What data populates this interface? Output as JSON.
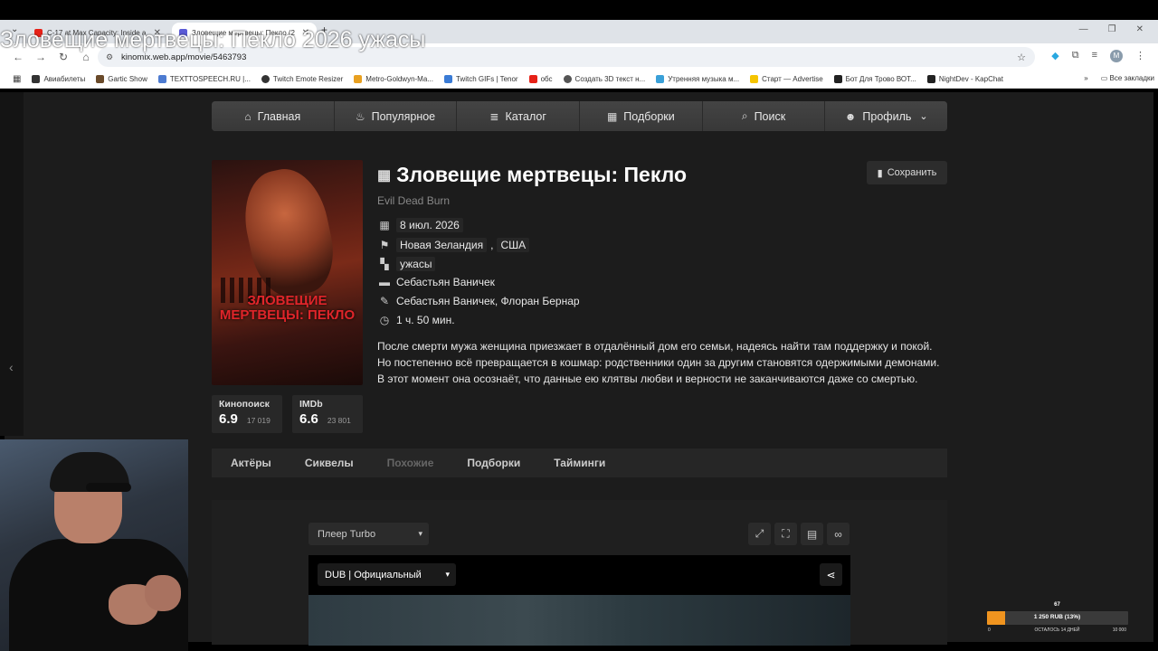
{
  "browser": {
    "tabs": [
      {
        "title": "C-17 at Max Capacity: Inside a",
        "favicon_color": "#e62117"
      },
      {
        "title": "Зловещие мертвецы: Пекло (2",
        "favicon_color": "#5b5bd6"
      }
    ],
    "new_tab_symbol": "+",
    "url": "kinomix.web.app/movie/5463793",
    "profile_initial": "M",
    "bookmarks": [
      {
        "label": "Авиабилеты",
        "icon_color": "#333"
      },
      {
        "label": "Gartic Show",
        "icon_color": "#6a4a2a"
      },
      {
        "label": "TEXTTOSPEECH.RU |...",
        "icon_color": "#4d7bd1"
      },
      {
        "label": "Twitch Emote Resizer",
        "icon_color": "#333"
      },
      {
        "label": "Metro-Goldwyn-Ma...",
        "icon_color": "#e8a020"
      },
      {
        "label": "Twitch GIFs | Tenor",
        "icon_color": "#3a7bd5"
      },
      {
        "label": "обс",
        "icon_color": "#e62117"
      },
      {
        "label": "Создать 3D текст н...",
        "icon_color": "#555"
      },
      {
        "label": "Утренняя музыка м...",
        "icon_color": "#3aa0d8"
      },
      {
        "label": "Старт — Advertise",
        "icon_color": "#f5c400"
      },
      {
        "label": "Бот Для Трово ВОТ...",
        "icon_color": "#222"
      },
      {
        "label": "NightDev - KapChat",
        "icon_color": "#222"
      }
    ],
    "all_bookmarks": "Все закладки"
  },
  "overlay_title": "Зловещие мертвецы: Пекло 2026 ужасы",
  "site_nav": [
    {
      "label": "Главная",
      "icon": "home-icon",
      "glyph": "⌂"
    },
    {
      "label": "Популярное",
      "icon": "fire-icon",
      "glyph": "♨"
    },
    {
      "label": "Каталог",
      "icon": "layers-icon",
      "glyph": "≣"
    },
    {
      "label": "Подборки",
      "icon": "collections-icon",
      "glyph": "▦"
    },
    {
      "label": "Поиск",
      "icon": "search-icon",
      "glyph": "⌕"
    },
    {
      "label": "Профиль",
      "icon": "user-icon",
      "glyph": "☻",
      "dropdown": "⌄"
    }
  ],
  "movie": {
    "title": "Зловещие мертвецы: Пекло",
    "original_title": "Evil Dead Burn",
    "poster_text": "ЗЛОВЕЩИЕ МЕРТВЕЦЫ: ПЕКЛО",
    "date": "8 июл. 2026",
    "countries": [
      "Новая Зеландия",
      "США"
    ],
    "country_sep": ",",
    "genre": "ужасы",
    "director": "Себастьян Ваничек",
    "writers": "Себастьян Ваничек, Флоран Бернар",
    "duration": "1 ч. 50 мин.",
    "description": "После смерти мужа женщина приезжает в отдалённый дом его семьи, надеясь найти там поддержку и покой. Но постепенно всё превращается в кошмар: родственники один за другим становятся одержимыми демонами. В этот момент она осознаёт, что данные ею клятвы любви и верности не заканчиваются даже со смертью.",
    "save_label": "Сохранить"
  },
  "ratings": [
    {
      "source": "Кинопоиск",
      "value": "6.9",
      "votes": "17 019"
    },
    {
      "source": "IMDb",
      "value": "6.6",
      "votes": "23 801"
    }
  ],
  "tabs": [
    {
      "label": "Актёры",
      "active": true
    },
    {
      "label": "Сиквелы",
      "active": true
    },
    {
      "label": "Похожие",
      "active": false
    },
    {
      "label": "Подборки",
      "active": true
    },
    {
      "label": "Тайминги",
      "active": true
    }
  ],
  "player": {
    "player_select": "Плеер Turbo",
    "dub_select": "DUB | Официальный"
  },
  "donation": {
    "count": "67",
    "amount": "1 250 RUB (13%)",
    "remaining": "ОСТАЛОСЬ 14 ДНЕЙ",
    "min": "0",
    "max": "10 000",
    "progress": 0.13,
    "color": "#f0941f"
  }
}
